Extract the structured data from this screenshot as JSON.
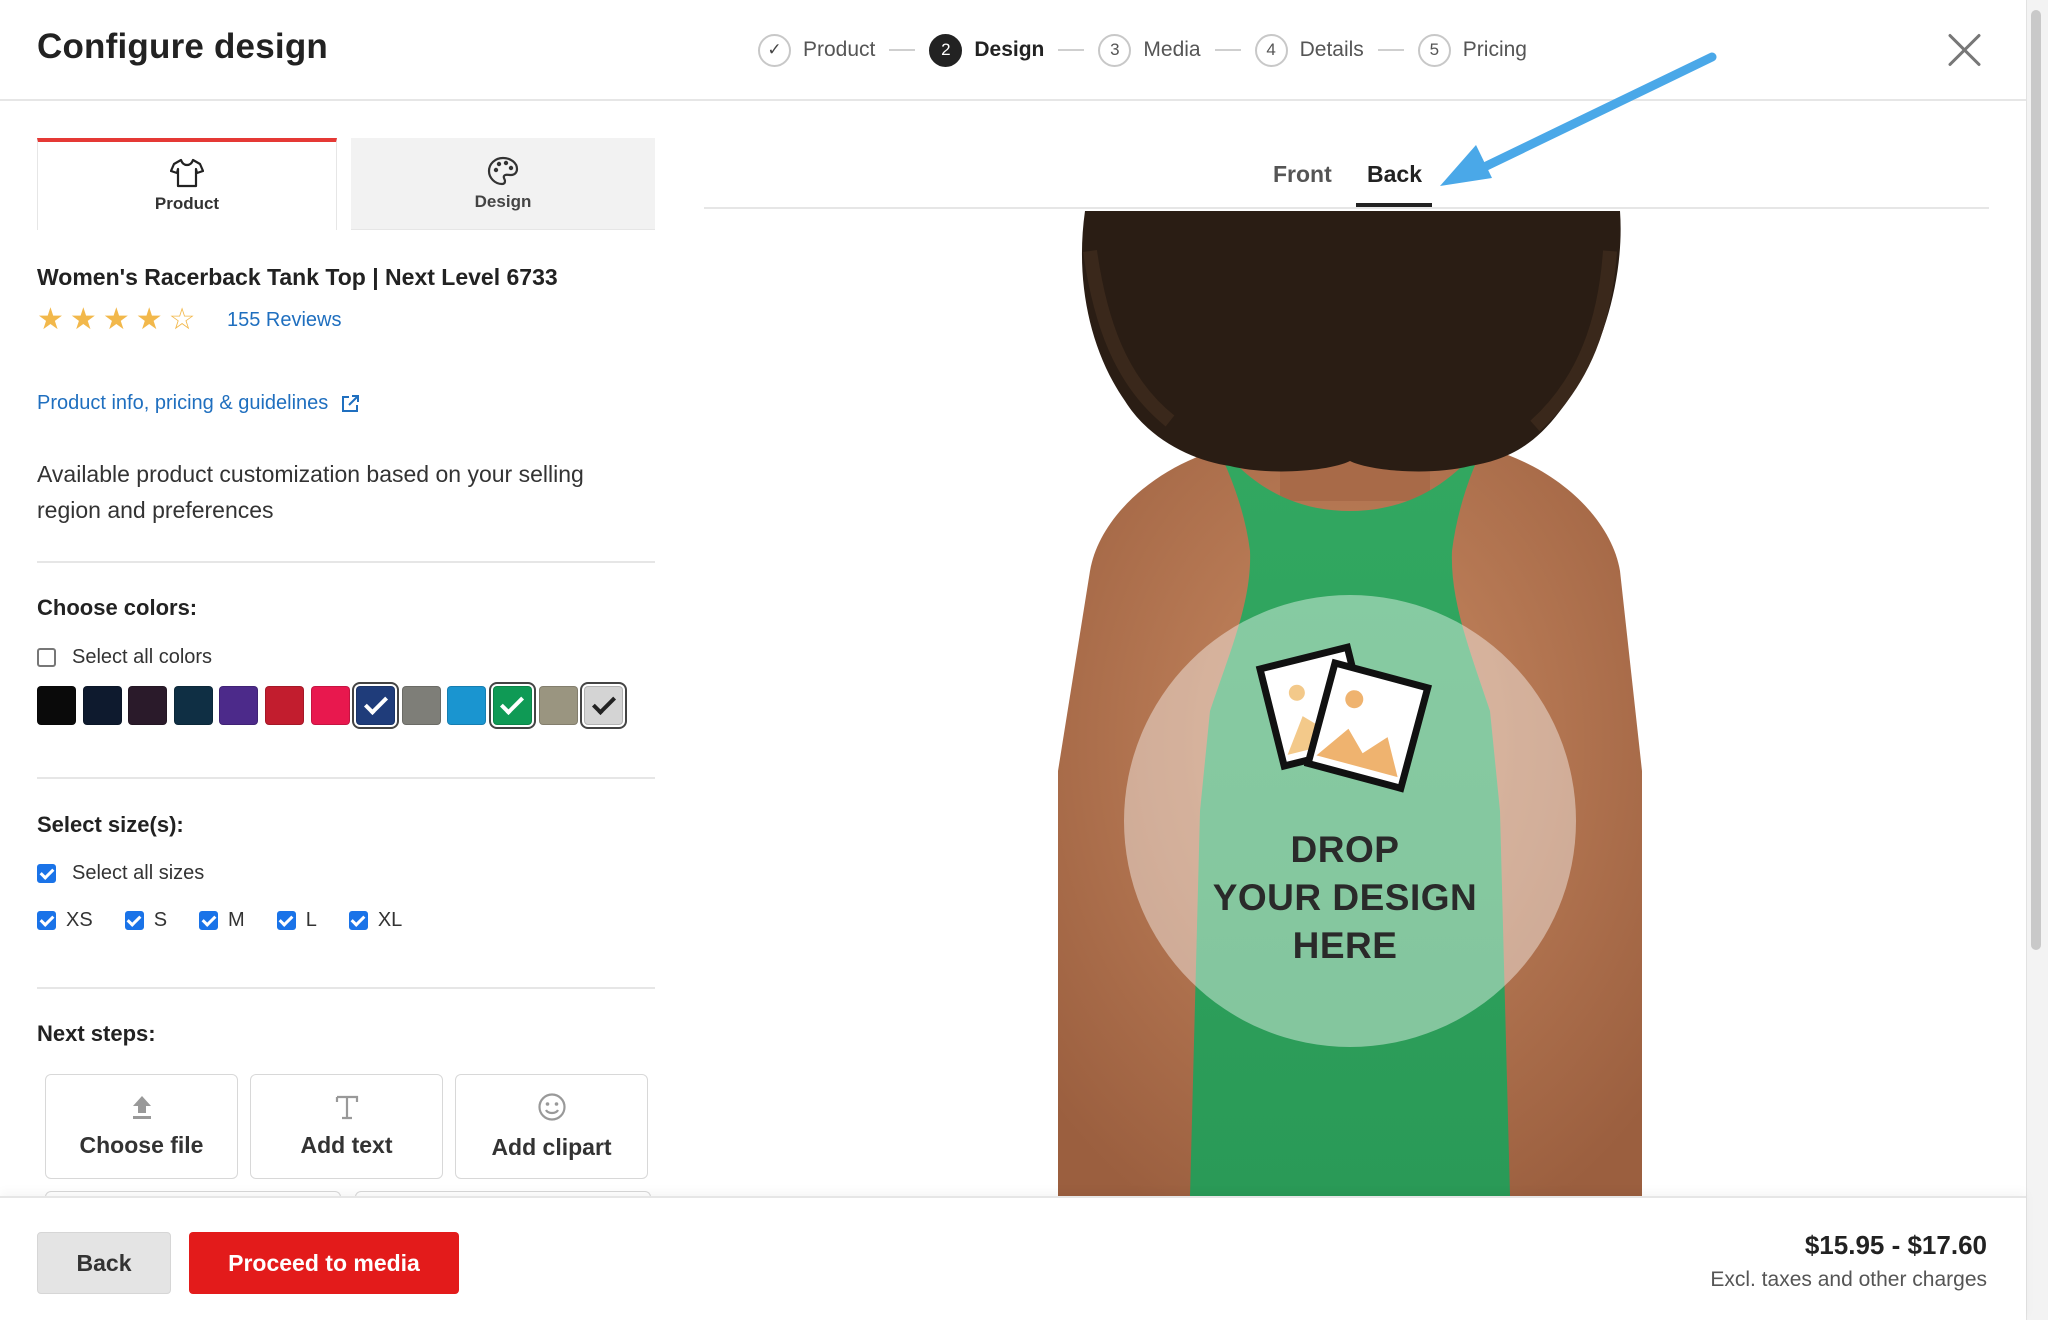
{
  "header": {
    "title": "Configure design",
    "steps": [
      {
        "number": "✓",
        "label": "Product",
        "state": "done"
      },
      {
        "number": "2",
        "label": "Design",
        "state": "active"
      },
      {
        "number": "3",
        "label": "Media",
        "state": "upcoming"
      },
      {
        "number": "4",
        "label": "Details",
        "state": "upcoming"
      },
      {
        "number": "5",
        "label": "Pricing",
        "state": "upcoming"
      }
    ],
    "close_icon": "close-icon"
  },
  "panel_tabs": {
    "product": {
      "label": "Product",
      "icon": "tshirt-icon",
      "active": true
    },
    "design": {
      "label": "Design",
      "icon": "palette-icon",
      "active": false
    }
  },
  "product": {
    "name": "Women's Racerback Tank Top | Next Level 6733",
    "rating": 4,
    "rating_max": 5,
    "reviews_label": "155 Reviews",
    "info_link": "Product info, pricing & guidelines",
    "description": "Available product customization based on your selling region and preferences"
  },
  "colors": {
    "title": "Choose colors:",
    "select_all_label": "Select all colors",
    "select_all_checked": false,
    "swatches": [
      {
        "hex": "#0a0a0a",
        "selected": false
      },
      {
        "hex": "#0e1a2e",
        "selected": false
      },
      {
        "hex": "#2a1a2a",
        "selected": false
      },
      {
        "hex": "#0f2f44",
        "selected": false
      },
      {
        "hex": "#4c2a8a",
        "selected": false
      },
      {
        "hex": "#c21d2e",
        "selected": false
      },
      {
        "hex": "#e8184e",
        "selected": false
      },
      {
        "hex": "#1f3c7a",
        "selected": true
      },
      {
        "hex": "#7e7e78",
        "selected": false
      },
      {
        "hex": "#1a95d0",
        "selected": false
      },
      {
        "hex": "#0f9a55",
        "selected": true
      },
      {
        "hex": "#9a9580",
        "selected": false
      },
      {
        "hex": "#d4d4d4",
        "selected": true,
        "light": true
      }
    ]
  },
  "sizes": {
    "title": "Select size(s):",
    "select_all_label": "Select all sizes",
    "select_all_checked": true,
    "items": [
      {
        "label": "XS",
        "checked": true
      },
      {
        "label": "S",
        "checked": true
      },
      {
        "label": "M",
        "checked": true
      },
      {
        "label": "L",
        "checked": true
      },
      {
        "label": "XL",
        "checked": true
      }
    ]
  },
  "next_steps": {
    "title": "Next steps:",
    "choose_file": {
      "label": "Choose file",
      "icon": "upload-icon"
    },
    "add_text": {
      "label": "Add text",
      "icon": "text-icon"
    },
    "add_clipart": {
      "label": "Add clipart",
      "icon": "smiley-icon"
    }
  },
  "view_tabs": {
    "front": "Front",
    "back": "Back",
    "active": "back"
  },
  "dropzone": {
    "line1": "DROP",
    "line2": "YOUR DESIGN",
    "line3": "HERE",
    "icon": "image-icon"
  },
  "colors_ui": {
    "accent_red": "#e31b1b",
    "link_blue": "#1f6fbf",
    "annotation_arrow": "#4aa8e8"
  },
  "footer": {
    "back_label": "Back",
    "proceed_label": "Proceed to media",
    "price": "$15.95 - $17.60",
    "price_note": "Excl. taxes and other charges"
  }
}
